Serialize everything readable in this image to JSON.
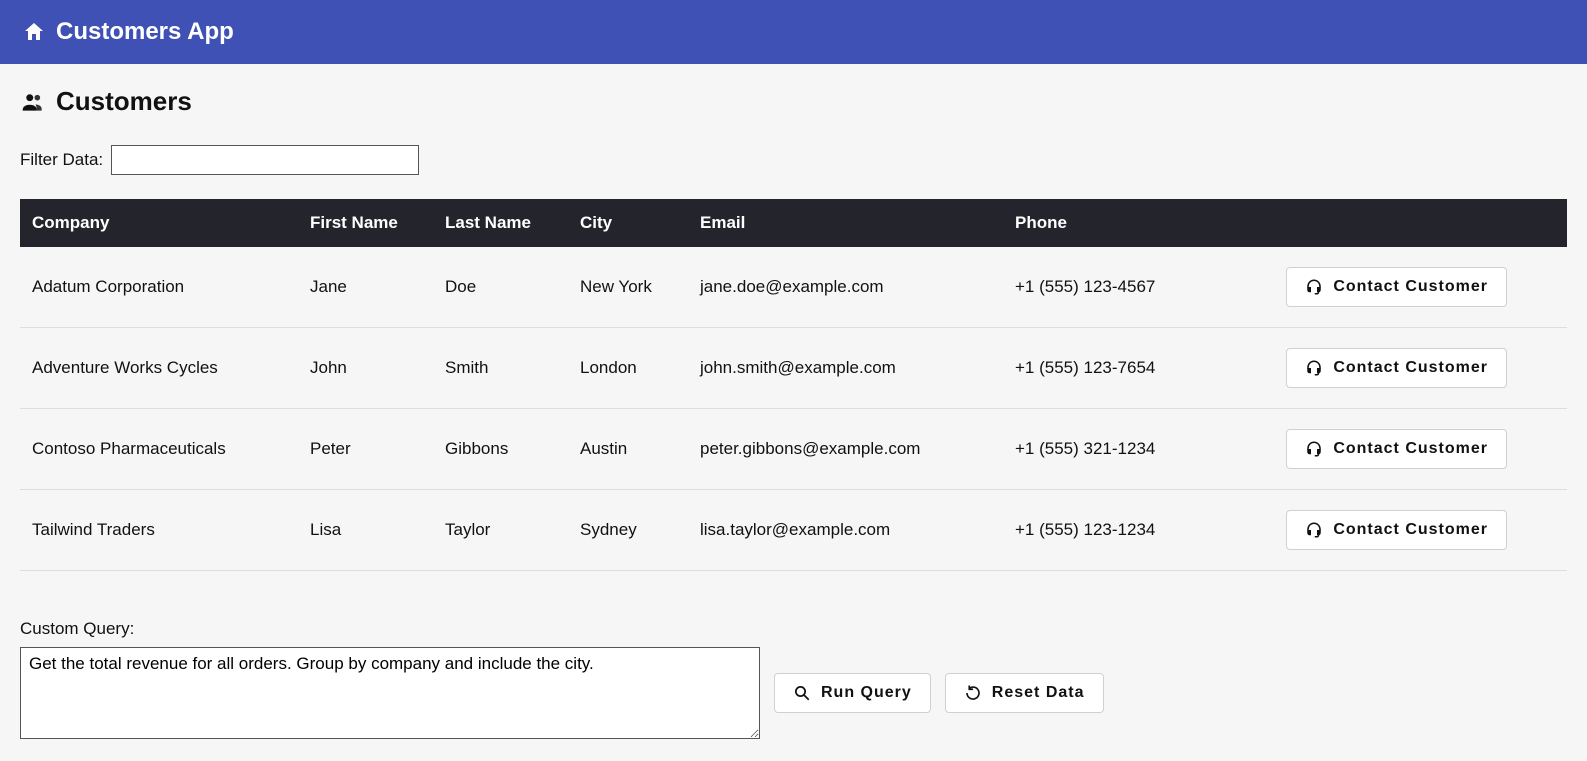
{
  "header": {
    "app_title": "Customers App"
  },
  "page": {
    "title": "Customers",
    "filter_label": "Filter Data:",
    "filter_value": ""
  },
  "table": {
    "columns": [
      "Company",
      "First Name",
      "Last Name",
      "City",
      "Email",
      "Phone"
    ],
    "contact_label": "Contact Customer",
    "rows": [
      {
        "company": "Adatum Corporation",
        "first": "Jane",
        "last": "Doe",
        "city": "New York",
        "email": "jane.doe@example.com",
        "phone": "+1 (555) 123-4567"
      },
      {
        "company": "Adventure Works Cycles",
        "first": "John",
        "last": "Smith",
        "city": "London",
        "email": "john.smith@example.com",
        "phone": "+1 (555) 123-7654"
      },
      {
        "company": "Contoso Pharmaceuticals",
        "first": "Peter",
        "last": "Gibbons",
        "city": "Austin",
        "email": "peter.gibbons@example.com",
        "phone": "+1 (555) 321-1234"
      },
      {
        "company": "Tailwind Traders",
        "first": "Lisa",
        "last": "Taylor",
        "city": "Sydney",
        "email": "lisa.taylor@example.com",
        "phone": "+1 (555) 123-1234"
      }
    ]
  },
  "query": {
    "label": "Custom Query:",
    "value": "Get the total revenue for all orders. Group by company and include the city.",
    "run_label": "Run Query",
    "reset_label": "Reset Data"
  }
}
